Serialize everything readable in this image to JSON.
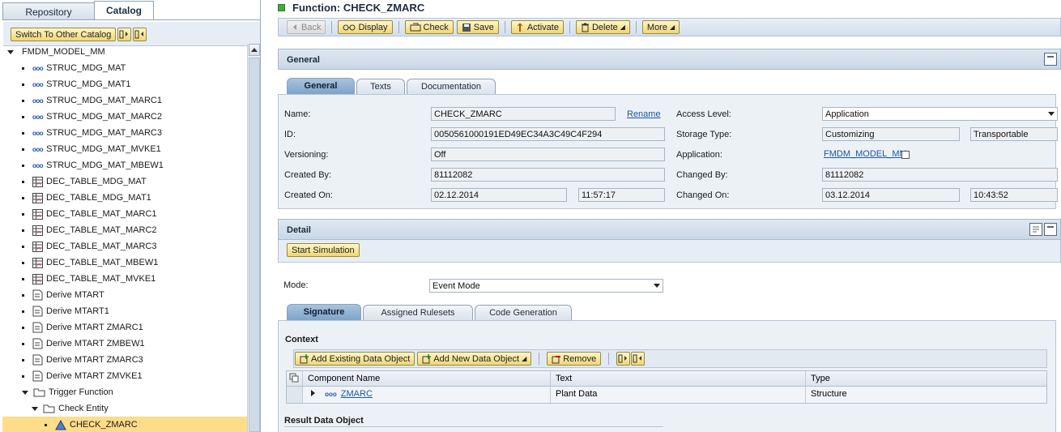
{
  "left": {
    "tabs": [
      "Repository",
      "Catalog"
    ],
    "switch_catalog": "Switch To Other Catalog",
    "tree": [
      {
        "label": "FMDM_MODEL_MM",
        "level": 0,
        "icon": "expand-arrow"
      },
      {
        "label": "STRUC_MDG_MAT",
        "level": 1,
        "icon": "structure-icon"
      },
      {
        "label": "STRUC_MDG_MAT1",
        "level": 1,
        "icon": "structure-icon"
      },
      {
        "label": "STRUC_MDG_MAT_MARC1",
        "level": 1,
        "icon": "structure-icon"
      },
      {
        "label": "STRUC_MDG_MAT_MARC2",
        "level": 1,
        "icon": "structure-icon"
      },
      {
        "label": "STRUC_MDG_MAT_MARC3",
        "level": 1,
        "icon": "structure-icon"
      },
      {
        "label": "STRUC_MDG_MAT_MVKE1",
        "level": 1,
        "icon": "structure-icon"
      },
      {
        "label": "STRUC_MDG_MAT_MBEW1",
        "level": 1,
        "icon": "structure-icon"
      },
      {
        "label": "DEC_TABLE_MDG_MAT",
        "level": 1,
        "icon": "decision-table-icon"
      },
      {
        "label": "DEC_TABLE_MDG_MAT1",
        "level": 1,
        "icon": "decision-table-icon"
      },
      {
        "label": "DEC_TABLE_MAT_MARC1",
        "level": 1,
        "icon": "decision-table-icon"
      },
      {
        "label": "DEC_TABLE_MAT_MARC2",
        "level": 1,
        "icon": "decision-table-icon"
      },
      {
        "label": "DEC_TABLE_MAT_MARC3",
        "level": 1,
        "icon": "decision-table-icon"
      },
      {
        "label": "DEC_TABLE_MAT_MBEW1",
        "level": 1,
        "icon": "decision-table-icon"
      },
      {
        "label": "DEC_TABLE_MAT_MVKE1",
        "level": 1,
        "icon": "decision-table-icon"
      },
      {
        "label": "Derive MTART",
        "level": 1,
        "icon": "ruleset-icon"
      },
      {
        "label": "Derive MTART1",
        "level": 1,
        "icon": "ruleset-icon"
      },
      {
        "label": "Derive MTART ZMARC1",
        "level": 1,
        "icon": "ruleset-icon"
      },
      {
        "label": "Derive MTART ZMBEW1",
        "level": 1,
        "icon": "ruleset-icon"
      },
      {
        "label": "Derive MTART ZMARC3",
        "level": 1,
        "icon": "ruleset-icon"
      },
      {
        "label": "Derive MTART ZMVKE1",
        "level": 1,
        "icon": "ruleset-icon"
      },
      {
        "label": "Trigger Function",
        "level": 1,
        "icon": "folder-icon"
      },
      {
        "label": "Check Entity",
        "level": 2,
        "icon": "folder-icon"
      },
      {
        "label": "CHECK_ZMARC",
        "level": 3,
        "icon": "function-icon",
        "selected": true
      }
    ]
  },
  "header": {
    "title": "Function: CHECK_ZMARC",
    "toolbar": {
      "back": "Back",
      "display": "Display",
      "check": "Check",
      "save": "Save",
      "activate": "Activate",
      "delete": "Delete",
      "more": "More"
    }
  },
  "general": {
    "section_title": "General",
    "tabs": [
      "General",
      "Texts",
      "Documentation"
    ],
    "fields": {
      "name_label": "Name:",
      "name_value": "CHECK_ZMARC",
      "rename_link": "Rename",
      "id_label": "ID:",
      "id_value": "0050561000191ED49EC34A3C49C4F294",
      "versioning_label": "Versioning:",
      "versioning_value": "Off",
      "created_by_label": "Created By:",
      "created_by_value": "81112082",
      "created_on_label": "Created On:",
      "created_on_date": "02.12.2014",
      "created_on_time": "11:57:17",
      "access_level_label": "Access Level:",
      "access_level_value": "Application",
      "storage_type_label": "Storage Type:",
      "storage_type_value": "Customizing",
      "storage_type_transport": "Transportable",
      "application_label": "Application:",
      "application_value": "FMDM_MODEL_MM",
      "changed_by_label": "Changed By:",
      "changed_by_value": "81112082",
      "changed_on_label": "Changed On:",
      "changed_on_date": "03.12.2014",
      "changed_on_time": "10:43:52"
    }
  },
  "detail": {
    "section_title": "Detail",
    "start_simulation": "Start Simulation",
    "mode_label": "Mode:",
    "mode_value": "Event Mode",
    "tabs": [
      "Signature",
      "Assigned Rulesets",
      "Code Generation"
    ],
    "context_title": "Context",
    "context_toolbar": {
      "add_existing": "Add Existing Data Object",
      "add_new": "Add New Data Object",
      "remove": "Remove"
    },
    "columns": [
      "Component Name",
      "Text",
      "Type"
    ],
    "rows": [
      {
        "name": "ZMARC",
        "text": "Plant Data",
        "type": "Structure"
      }
    ],
    "result_title": "Result Data Object"
  }
}
